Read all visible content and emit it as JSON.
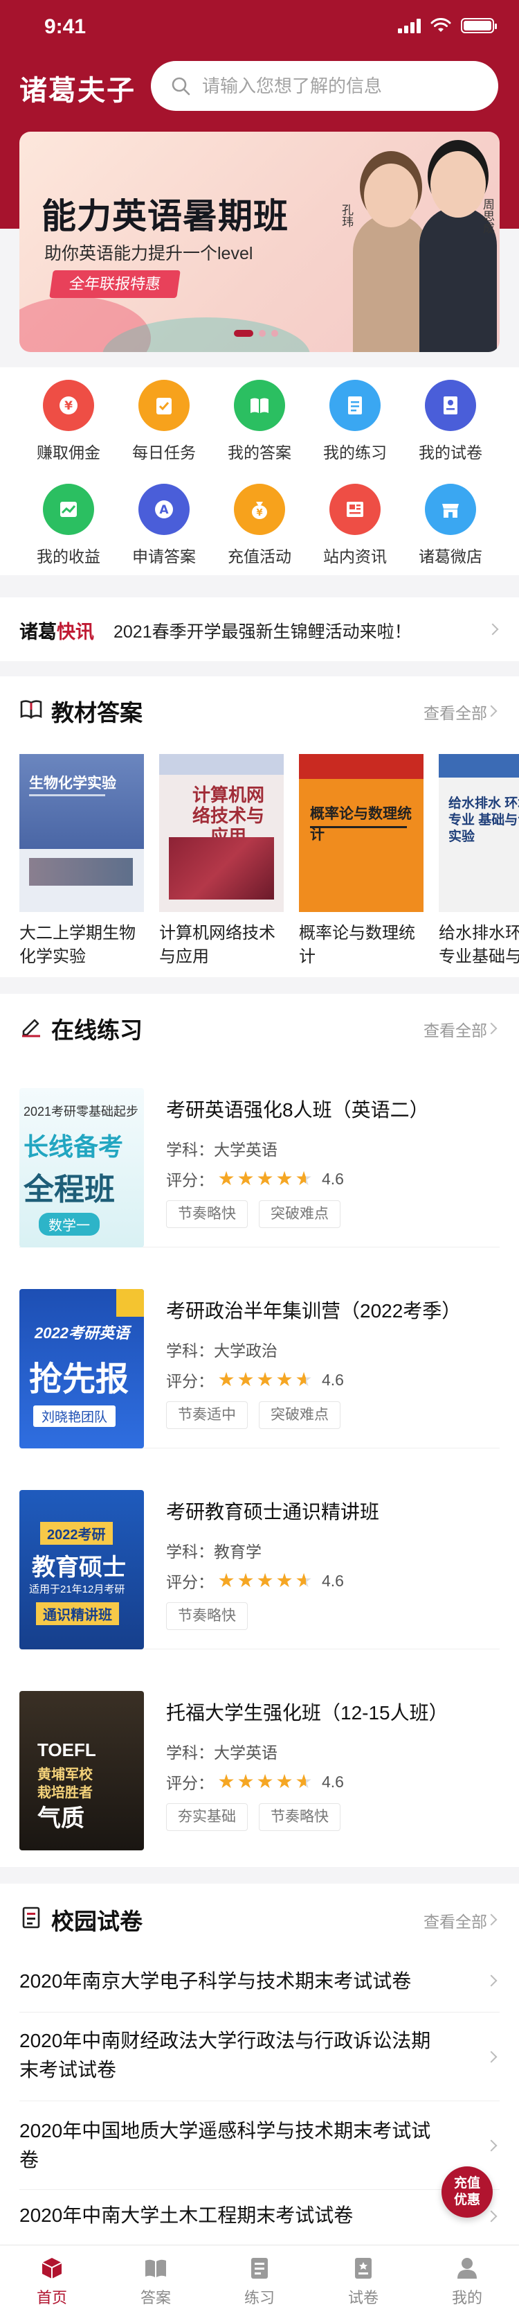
{
  "status": {
    "time": "9:41"
  },
  "header": {
    "brand": "诸葛夫子",
    "search_placeholder": "请输入您想了解的信息"
  },
  "banner": {
    "title": "能力英语暑期班",
    "subtitle": "助你英语能力提升一个level",
    "tag": "全年联报特惠",
    "teacher1": "孔玮",
    "teacher2": "周思成"
  },
  "quick_menu": [
    {
      "label": "赚取佣金",
      "icon": "yen-coin-icon",
      "color": "#ee4e45"
    },
    {
      "label": "每日任务",
      "icon": "task-icon",
      "color": "#f7a21c"
    },
    {
      "label": "我的答案",
      "icon": "book-icon",
      "color": "#2bbf61"
    },
    {
      "label": "我的练习",
      "icon": "document-icon",
      "color": "#3aa7f2"
    },
    {
      "label": "我的试卷",
      "icon": "exam-paper-icon",
      "color": "#4a5ed9"
    },
    {
      "label": "我的收益",
      "icon": "trend-icon",
      "color": "#2bbf61"
    },
    {
      "label": "申请答案",
      "icon": "answer-a-icon",
      "color": "#4a5ed9"
    },
    {
      "label": "充值活动",
      "icon": "money-bag-icon",
      "color": "#f7a21c"
    },
    {
      "label": "站内资讯",
      "icon": "news-icon",
      "color": "#ee4e45"
    },
    {
      "label": "诸葛微店",
      "icon": "shop-icon",
      "color": "#3aa7f2"
    }
  ],
  "news": {
    "brand_a": "诸葛",
    "brand_b": "快讯",
    "text": "2021春季开学最强新生锦鲤活动来啦！"
  },
  "textbooks": {
    "title": "教材答案",
    "more": "查看全部",
    "items": [
      {
        "title": "大二上学期生物化学实验",
        "cover_title": "生物化学实验"
      },
      {
        "title": "计算机网络技术与应用",
        "cover_title": "计算机网络技术与应用"
      },
      {
        "title": "概率论与数理统计",
        "cover_title": "概率论与数理统计"
      },
      {
        "title": "给水排水环境与专业基础与专业实验",
        "cover_title": "给水排水 环境 与专业 基础与专业实验"
      }
    ]
  },
  "practice": {
    "title": "在线练习",
    "more": "查看全部",
    "subject_label": "学科：",
    "rating_label": "评分：",
    "items": [
      {
        "title": "考研英语强化8人班（英语二）",
        "subject": "大学英语",
        "rating": 4.6,
        "rating_text": "4.6",
        "tags": [
          "节奏略快",
          "突破难点"
        ],
        "thumb": {
          "line1": "2021考研零基础起步",
          "line2": "长线备考",
          "line3": "全程班",
          "line4": "数学一"
        }
      },
      {
        "title": "考研政治半年集训营（2022考季）",
        "subject": "大学政治",
        "rating": 4.6,
        "rating_text": "4.6",
        "tags": [
          "节奏适中",
          "突破难点"
        ],
        "thumb": {
          "line1": "2022考研英语",
          "line2": "抢先报",
          "line3": "刘晓艳团队",
          "line4": ""
        }
      },
      {
        "title": "考研教育硕士通识精讲班",
        "subject": "教育学",
        "rating": 4.6,
        "rating_text": "4.6",
        "tags": [
          "节奏略快"
        ],
        "thumb": {
          "line1": "2022考研",
          "line2": "教育硕士",
          "line3": "适用于21年12月考研",
          "line4": "通识精讲班"
        }
      },
      {
        "title": "托福大学生强化班（12-15人班）",
        "subject": "大学英语",
        "rating": 4.6,
        "rating_text": "4.6",
        "tags": [
          "夯实基础",
          "节奏略快"
        ],
        "thumb": {
          "line1": "TOEFL",
          "line2": "黄埔军校",
          "line3": "栽培胜者",
          "line4": "气质"
        }
      }
    ]
  },
  "exams": {
    "title": "校园试卷",
    "more": "查看全部",
    "items": [
      "2020年南京大学电子科学与技术期末考试试卷",
      "2020年中南财经政法大学行政法与行政诉讼法期末考试试卷",
      "2020年中国地质大学遥感科学与技术期末考试试卷",
      "2020年中南大学土木工程期末考试试卷"
    ]
  },
  "float_button": {
    "line1": "充值",
    "line2": "优惠"
  },
  "tabbar": [
    {
      "label": "首页",
      "icon": "home-icon",
      "active": true
    },
    {
      "label": "答案",
      "icon": "book-open-icon",
      "active": false
    },
    {
      "label": "练习",
      "icon": "practice-icon",
      "active": false
    },
    {
      "label": "试卷",
      "icon": "exam-icon",
      "active": false
    },
    {
      "label": "我的",
      "icon": "user-icon",
      "active": false
    }
  ],
  "colors": {
    "brand": "#a6132d",
    "accent": "#b1142f",
    "star": "#f5a623"
  }
}
